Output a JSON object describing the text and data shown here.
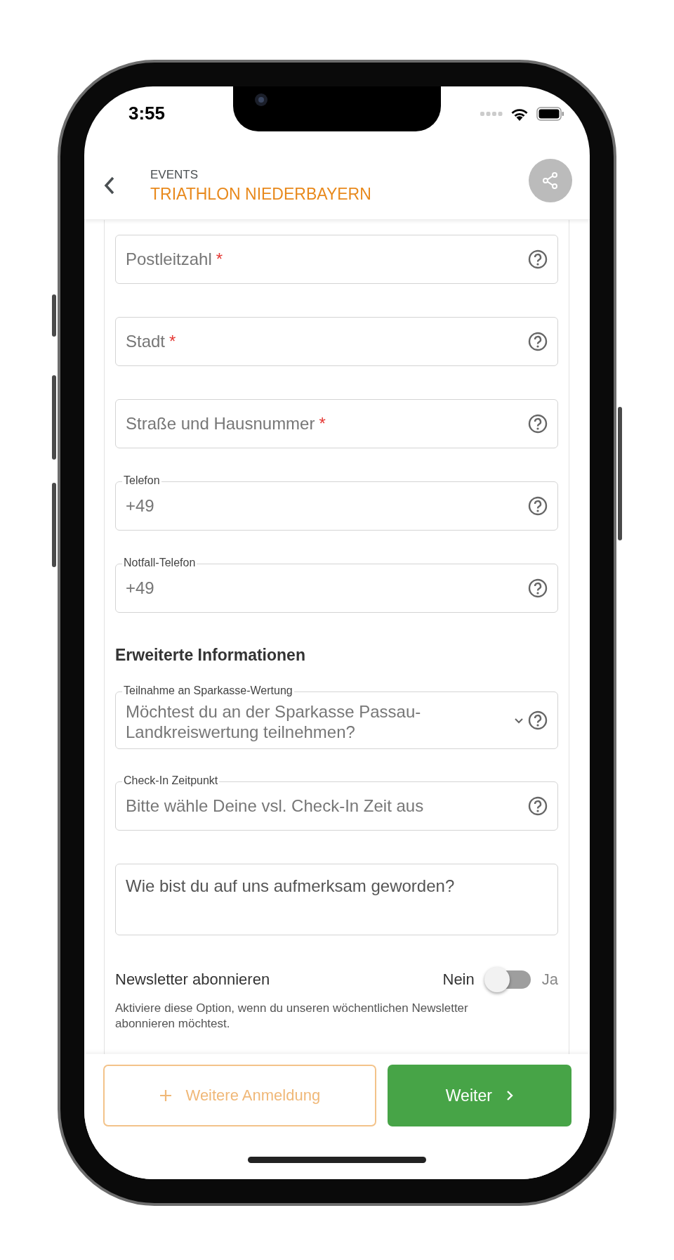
{
  "status_bar": {
    "time": "3:55"
  },
  "header": {
    "section": "EVENTS",
    "title": "TRIATHLON NIEDERBAYERN"
  },
  "fields": [
    {
      "kind": "input",
      "placeholder": "Postleitzahl",
      "required_mark": "*",
      "help": true
    },
    {
      "kind": "input",
      "placeholder": "Stadt",
      "required_mark": "*",
      "help": true
    },
    {
      "kind": "input",
      "placeholder": "Straße und Hausnummer",
      "required_mark": "*",
      "help": true
    },
    {
      "kind": "input",
      "label": "Telefon",
      "value": "+49",
      "help": true
    },
    {
      "kind": "input",
      "label": "Notfall-Telefon",
      "value": "+49",
      "help": true
    },
    {
      "kind": "heading",
      "text": "Erweiterte Informationen"
    },
    {
      "kind": "select",
      "label": "Teilnahme an Sparkasse-Wertung",
      "placeholder": "Möchtest du an der Sparkasse Passau-Landkreiswertung teilnehmen?",
      "help": true
    },
    {
      "kind": "input",
      "label": "Check-In Zeitpunkt",
      "placeholder": "Bitte wähle Deine vsl. Check-In Zeit aus",
      "help": true
    },
    {
      "kind": "textarea",
      "placeholder": "Wie bist du auf uns aufmerksam geworden?",
      "help": false
    }
  ],
  "newsletter": {
    "label": "Newsletter abonnieren",
    "off_label": "Nein",
    "on_label": "Ja",
    "on": false,
    "description": "Aktiviere diese Option, wenn du unseren wöchentlichen Newsletter abonnieren möchtest."
  },
  "buttons": [
    {
      "kind": "secondary",
      "label": "Weitere Anmeldung"
    },
    {
      "kind": "primary",
      "label": "Weiter"
    }
  ]
}
